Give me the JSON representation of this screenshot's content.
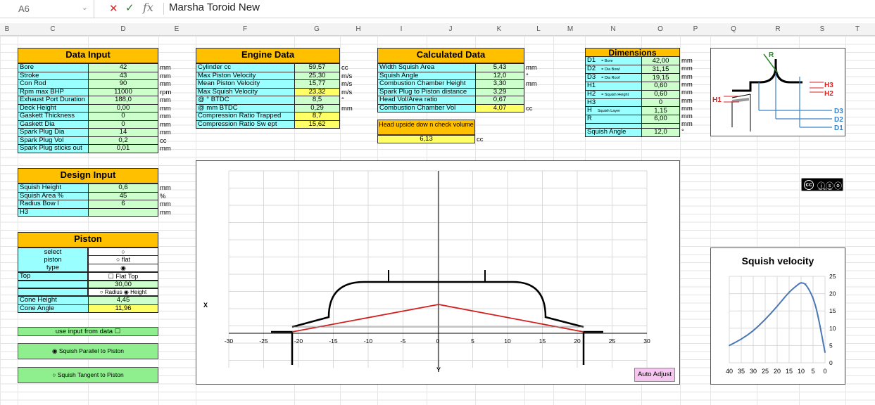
{
  "formula_bar": {
    "cell": "A6",
    "cancel": "✕",
    "confirm": "✓",
    "fx": "fx",
    "content": "Marsha Toroid New"
  },
  "columns": [
    [
      "B",
      10
    ],
    [
      "C",
      75
    ],
    [
      "D",
      175
    ],
    [
      "E",
      251
    ],
    [
      "F",
      348
    ],
    [
      "G",
      450
    ],
    [
      "H",
      509
    ],
    [
      "I",
      570
    ],
    [
      "J",
      640
    ],
    [
      "K",
      709
    ],
    [
      "L",
      765
    ],
    [
      "M",
      810
    ],
    [
      "N",
      871
    ],
    [
      "O",
      938
    ],
    [
      "P",
      988
    ],
    [
      "Q",
      1042
    ],
    [
      "R",
      1105
    ],
    [
      "S",
      1168
    ],
    [
      "T",
      1218
    ]
  ],
  "data_input": {
    "title": "Data Input",
    "rows": [
      {
        "label": "Bore",
        "value": "42",
        "unit": "mm"
      },
      {
        "label": "Stroke",
        "value": "43",
        "unit": "mm"
      },
      {
        "label": "Con  Rod",
        "value": "90",
        "unit": "mm"
      },
      {
        "label": "Rpm max BHP",
        "value": "11000",
        "unit": "rpm"
      },
      {
        "label": "Exhaust Port Duration",
        "value": "188,0",
        "unit": "mm"
      },
      {
        "label": "Deck  Height",
        "value": "0,00",
        "unit": "mm"
      },
      {
        "label": "Gaskett  Thickness",
        "value": "0",
        "unit": "mm"
      },
      {
        "label": "Gaskett  Dia",
        "value": "0",
        "unit": "mm"
      },
      {
        "label": "Spark  Plug  Dia",
        "value": "14",
        "unit": "mm"
      },
      {
        "label": "Spark  Plug  Vol",
        "value": "0,2",
        "unit": "cc"
      },
      {
        "label": "Spark Plug sticks out",
        "value": "0,01",
        "unit": "mm"
      }
    ]
  },
  "engine_data": {
    "title": "Engine Data",
    "rows": [
      {
        "label": "Cylinder  cc",
        "value": "59,57",
        "unit": "cc"
      },
      {
        "label": "Max  Piston  Velocity",
        "value": "25,30",
        "unit": "m/s"
      },
      {
        "label": "Mean  Piston  Velocity",
        "value": "15,77",
        "unit": "m/s"
      },
      {
        "label": "Max  Squish Velocity",
        "value": "23,32",
        "unit": "m/s"
      },
      {
        "label": "@     °     BTDC",
        "value": "8,5",
        "unit": "°"
      },
      {
        "label": "@     mm BTDC",
        "value": "0,29",
        "unit": "mm"
      },
      {
        "label": "Compression  Ratio  Trapped",
        "value": "8,7",
        "unit": ""
      },
      {
        "label": "Compression  Ratio  Sw ept",
        "value": "15,62",
        "unit": ""
      }
    ]
  },
  "calculated_data": {
    "title": "Calculated Data",
    "rows": [
      {
        "label": "Width  Squish  Area",
        "value": "5,43",
        "unit": "mm"
      },
      {
        "label": "Squish  Angle",
        "value": "12,0",
        "unit": "°"
      },
      {
        "label": "Combustion  Chamber  Height",
        "value": "3,30",
        "unit": "mm"
      },
      {
        "label": "Spark Plug to Piston distance",
        "value": "3,29",
        "unit": ""
      },
      {
        "label": "Head  Vol/Area  ratio",
        "value": "0,67",
        "unit": ""
      },
      {
        "label": "Combustion  Chamber  Vol",
        "value": "4,07",
        "unit": "cc"
      }
    ],
    "head_label": "Head upside dow n check volume",
    "head_value": "6,13",
    "head_unit": "cc"
  },
  "dimensions": {
    "title": "Dimensions",
    "rows": [
      {
        "label": "D1",
        "note": "= Bore",
        "value": "42,00",
        "unit": "mm"
      },
      {
        "label": "D2",
        "note": "= Dia Bowl",
        "value": "31,15",
        "unit": "mm"
      },
      {
        "label": "D3",
        "note": "= Dia Roof",
        "value": "19,15",
        "unit": "mm"
      },
      {
        "label": "H1",
        "note": "",
        "value": "0,60",
        "unit": "mm"
      },
      {
        "label": "H2",
        "note": "= Squish Height",
        "value": "0,60",
        "unit": "mm"
      },
      {
        "label": "H3",
        "note": "",
        "value": "0",
        "unit": "mm"
      },
      {
        "label": "H",
        "note": "Squish Layer",
        "value": "1,15",
        "unit": "mm"
      },
      {
        "label": "R",
        "note": "",
        "value": "6,00",
        "unit": "mm"
      },
      {
        "label": "",
        "note": "",
        "value": "",
        "unit": "mm"
      }
    ],
    "squish_angle_label": "Squish Angle",
    "squish_angle_value": "12,0",
    "squish_angle_unit": "°"
  },
  "diagram_labels": {
    "r": "R",
    "h1": "H1",
    "h2": "H2",
    "h3": "H3",
    "d1": "D1",
    "d2": "D2",
    "d3": "D3"
  },
  "design_input": {
    "title": "Design Input",
    "rows": [
      {
        "label": "Squish  Height",
        "value": "0,6",
        "unit": "mm"
      },
      {
        "label": "Squish  Area    %",
        "value": "45",
        "unit": "%"
      },
      {
        "label": "Radius  Bow l",
        "value": "6",
        "unit": "mm"
      },
      {
        "label": "H3",
        "value": "",
        "unit": "mm"
      }
    ]
  },
  "piston": {
    "title": "Piston",
    "select_label": "select piston type",
    "options": [
      "",
      "flat",
      ""
    ],
    "top_label": "Top",
    "flat_top": "Flat Top",
    "top_value": "30,00",
    "radius_opt": "Radius",
    "height_opt": "Height",
    "cone_height_label": "Cone Height",
    "cone_height_value": "4,45",
    "cone_angle_label": "Cone Angle",
    "cone_angle_value": "11,96"
  },
  "buttons": {
    "use_input": "use input from data",
    "squish_parallel": "Squish Parallel to Piston",
    "squish_tangent": "Squish Tangent to Piston",
    "auto_adjust": "Auto Adjust"
  },
  "cc_badge": {
    "text": "cc",
    "sub": "BY  NC  SA"
  },
  "chamber_chart": {
    "xlabel": "X",
    "ylabel": "Y",
    "x_ticks": [
      "-30",
      "-25",
      "-20",
      "-15",
      "-10",
      "-5",
      "0",
      "5",
      "10",
      "15",
      "20",
      "25",
      "30"
    ]
  },
  "chart_data": {
    "type": "line",
    "title": "Squish velocity",
    "xlabel": "",
    "ylabel": "",
    "x_ticks": [
      "40",
      "35",
      "30",
      "25",
      "20",
      "15",
      "10",
      "5",
      "0"
    ],
    "y_ticks": [
      "0",
      "5",
      "10",
      "15",
      "20",
      "25"
    ],
    "xlim": [
      40,
      0
    ],
    "ylim": [
      0,
      25
    ],
    "x": [
      40,
      35,
      30,
      25,
      20,
      15,
      11,
      10,
      8,
      5,
      3,
      0
    ],
    "y": [
      5,
      6.8,
      9.2,
      12.5,
      16.3,
      20.5,
      22.8,
      23.2,
      22.8,
      19,
      14,
      3
    ],
    "color": "#4a78b5"
  }
}
